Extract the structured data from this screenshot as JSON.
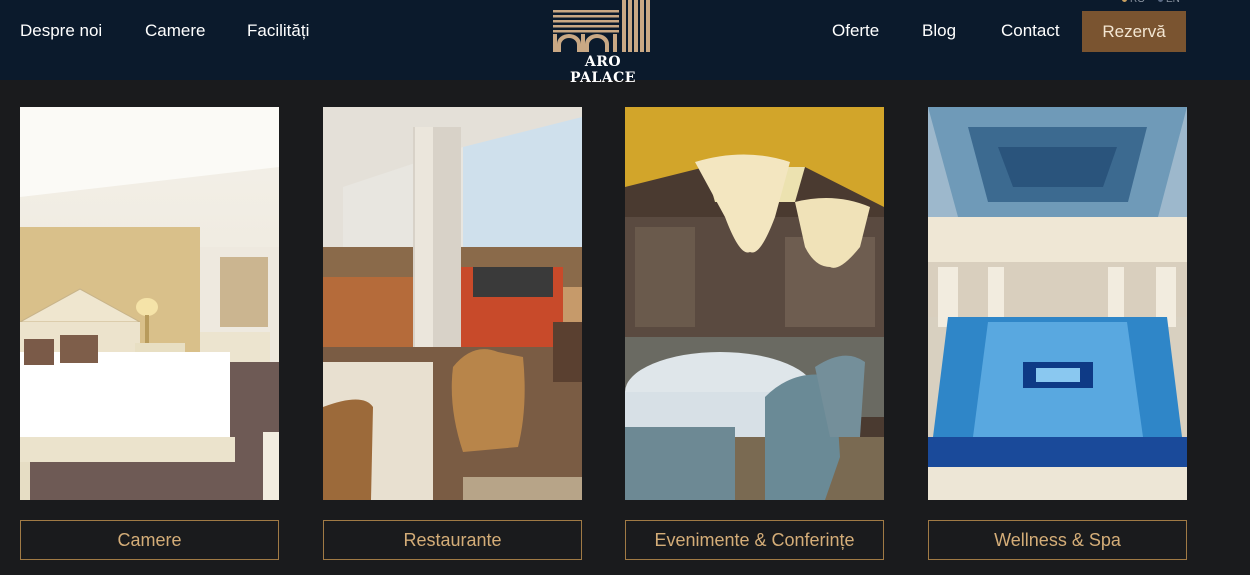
{
  "header": {
    "nav_left": [
      "Despre noi",
      "Camere",
      "Facilități"
    ],
    "nav_right": [
      "Oferte",
      "Blog",
      "Contact"
    ],
    "logo_text": "ARO PALACE",
    "languages": [
      "RO",
      "EN"
    ],
    "cta_label": "Rezervă"
  },
  "cards": [
    {
      "label": "Camere",
      "image": "hotel-room-photo"
    },
    {
      "label": "Restaurante",
      "image": "restaurant-photo"
    },
    {
      "label": "Evenimente & Conferințe",
      "image": "ballroom-photo"
    },
    {
      "label": "Wellness & Spa",
      "image": "indoor-pool-photo"
    }
  ],
  "colors": {
    "header_bg": "#0b1a2c",
    "page_bg": "#1a1b1d",
    "accent_gold": "#c9a060",
    "button_bg": "#7a5430",
    "card_border": "#a07a45"
  }
}
